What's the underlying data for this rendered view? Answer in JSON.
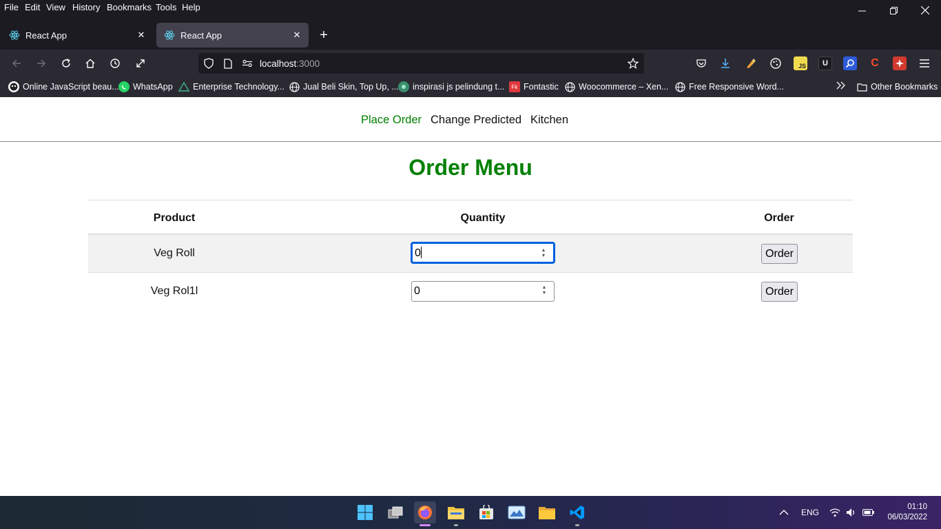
{
  "browser": {
    "menu": [
      "File",
      "Edit",
      "View",
      "History",
      "Bookmarks",
      "Tools",
      "Help"
    ],
    "tabs": [
      {
        "title": "React App",
        "active": false
      },
      {
        "title": "React App",
        "active": true
      }
    ],
    "url": {
      "host": "localhost",
      "port": ":3000"
    },
    "bookmarks": [
      {
        "label": "Online JavaScript beau...",
        "icon": "ghost-icon"
      },
      {
        "label": "WhatsApp",
        "icon": "whatsapp-icon"
      },
      {
        "label": "Enterprise Technology...",
        "icon": "triangle-logo-icon"
      },
      {
        "label": "Jual Beli Skin, Top Up, ...",
        "icon": "globe-icon"
      },
      {
        "label": "inspirasi js pelindung t...",
        "icon": "site-logo-icon"
      },
      {
        "label": "Fontastic",
        "icon": "fontastic-icon"
      },
      {
        "label": "Woocommerce – Xen...",
        "icon": "globe-icon"
      },
      {
        "label": "Free Responsive Word...",
        "icon": "globe-icon"
      }
    ],
    "other_bookmarks": "Other Bookmarks"
  },
  "app": {
    "nav": [
      {
        "label": "Place Order",
        "active": true
      },
      {
        "label": "Change Predicted",
        "active": false
      },
      {
        "label": "Kitchen",
        "active": false
      }
    ],
    "title": "Order Menu",
    "table": {
      "headers": {
        "product": "Product",
        "quantity": "Quantity",
        "order": "Order"
      },
      "rows": [
        {
          "product": "Veg Roll",
          "quantity": "0",
          "button": "Order",
          "focused": true
        },
        {
          "product": "Veg Rol1l",
          "quantity": "0",
          "button": "Order",
          "focused": false
        }
      ]
    }
  },
  "taskbar": {
    "language": "ENG",
    "time": "01:10",
    "date": "06/03/2022"
  },
  "colors": {
    "accent": "#008000",
    "chrome_dark": "#1c1b22",
    "toolbar": "#2b2a33"
  }
}
